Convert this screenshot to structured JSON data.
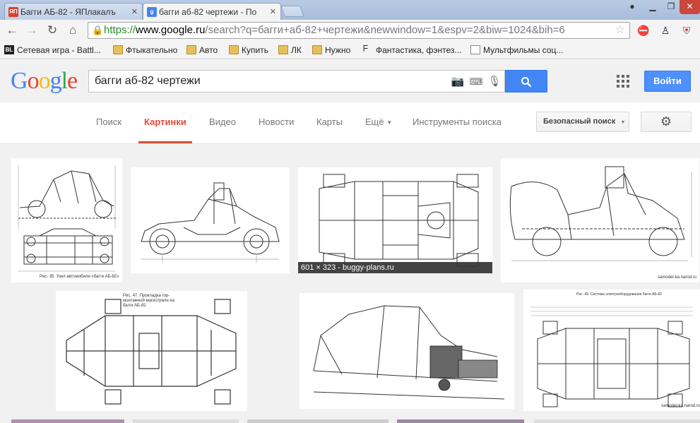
{
  "browser": {
    "tabs": [
      {
        "title": "Багги АБ-82 - ЯПлакалъ",
        "favicon": "ЯП",
        "favicon_color": "#d9402b",
        "active": false
      },
      {
        "title": "багги аб-82 чертежи - По",
        "favicon": "g",
        "favicon_color": "#4285f4",
        "active": true
      }
    ],
    "url": {
      "scheme": "https://",
      "host": "www.google.ru",
      "path": "/search?q=багги+аб-82+чертежи&newwindow=1&espv=2&biw=1024&bih=6"
    },
    "bookmarks": [
      {
        "label": "Сетевая игра - Battl...",
        "icon": "bl-icon"
      },
      {
        "label": "Фтыкательно",
        "icon": "folder-icon"
      },
      {
        "label": "Авто",
        "icon": "folder-icon"
      },
      {
        "label": "Купить",
        "icon": "folder-icon"
      },
      {
        "label": "ЛК",
        "icon": "folder-icon"
      },
      {
        "label": "Нужно",
        "icon": "folder-icon"
      },
      {
        "label": "Фантастика, фэнтез...",
        "icon": "book-icon"
      },
      {
        "label": "Мультфильмы соц...",
        "icon": "page-icon"
      }
    ]
  },
  "google": {
    "query": "багги аб-82 чертежи",
    "signin_label": "Войти",
    "nav_tabs": [
      "Поиск",
      "Картинки",
      "Видео",
      "Новости",
      "Карты",
      "Ещё",
      "Инструменты поиска"
    ],
    "active_tab": "Картинки",
    "safe_search_label": "Безопасный поиск",
    "accent_color": "#dd4b39",
    "button_color": "#4285f4"
  },
  "results": {
    "hover_info": "601 × 323 - buggy-plans.ru",
    "captions": {
      "r1": "Рис. 35. Узел автомобиля «багги АБ-82»",
      "r5": "Рис. 47. Прокладка гор-\nмонтажной магистрали на\nбагги АБ-82",
      "r7": "Рис. 49. Система электрооборудования багги АБ-82",
      "watermark": "samodel-ka.narod.ru"
    }
  }
}
